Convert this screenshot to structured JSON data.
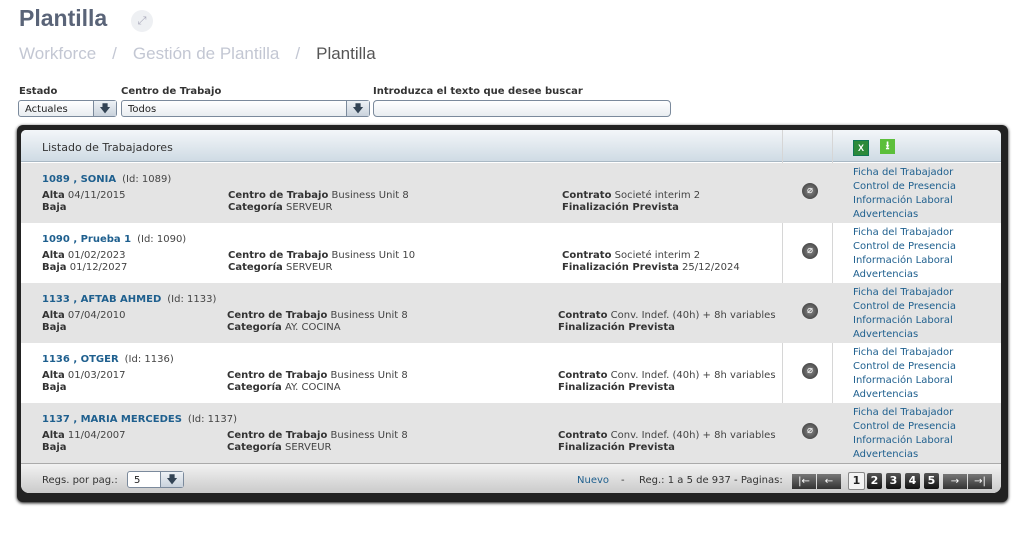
{
  "page": {
    "title": "Plantilla",
    "breadcrumb": [
      "Workforce",
      "Gestión de Plantilla",
      "Plantilla"
    ]
  },
  "filters": {
    "estado_label": "Estado",
    "estado_value": "Actuales",
    "centro_label": "Centro de Trabajo",
    "centro_value": "Todos",
    "search_label": "Introduzca el texto que desee buscar",
    "search_value": ""
  },
  "list": {
    "title": "Listado de Trabajadores",
    "links": [
      "Ficha del Trabajador",
      "Control de Presencia",
      "Información Laboral",
      "Advertencias"
    ],
    "labels": {
      "alta": "Alta",
      "baja": "Baja",
      "centro": "Centro de Trabajo",
      "categoria": "Categoría",
      "contrato": "Contrato",
      "fin": "Finalización Prevista"
    },
    "rows": [
      {
        "name": "1089 , SONIA",
        "id": "(Id: 1089)",
        "alta": "04/11/2015",
        "baja": "",
        "centro": "Business Unit 8",
        "categoria": "SERVEUR",
        "contrato": "Societé interim 2",
        "fin": ""
      },
      {
        "name": "1090 , Prueba 1",
        "id": "(Id: 1090)",
        "alta": "01/02/2023",
        "baja": "01/12/2027",
        "centro": "Business Unit 10",
        "categoria": "SERVEUR",
        "contrato": "Societé interim 2",
        "fin": "25/12/2024"
      },
      {
        "name": "1133 , AFTAB AHMED",
        "id": "(Id: 1133)",
        "alta": "07/04/2010",
        "baja": "",
        "centro": "Business Unit 8",
        "categoria": "AY. COCINA",
        "contrato": "Conv. Indef. (40h) + 8h variables",
        "fin": ""
      },
      {
        "name": "1136 , OTGER",
        "id": "(Id: 1136)",
        "alta": "01/03/2017",
        "baja": "",
        "centro": "Business Unit 8",
        "categoria": "AY. COCINA",
        "contrato": "Conv. Indef. (40h) + 8h variables",
        "fin": ""
      },
      {
        "name": "1137 , MARIA MERCEDES",
        "id": "(Id: 1137)",
        "alta": "11/04/2007",
        "baja": "",
        "centro": "Business Unit 8",
        "categoria": "SERVEUR",
        "contrato": "Conv. Indef. (40h) + 8h variables",
        "fin": ""
      }
    ]
  },
  "footer": {
    "per_page_label": "Regs. por pag.:",
    "per_page": "5",
    "nuevo": "Nuevo",
    "dash": "-",
    "records": "Reg.: 1 a 5 de 937 - Paginas:",
    "pages": [
      "1",
      "2",
      "3",
      "4",
      "5"
    ],
    "current_page": "1"
  }
}
